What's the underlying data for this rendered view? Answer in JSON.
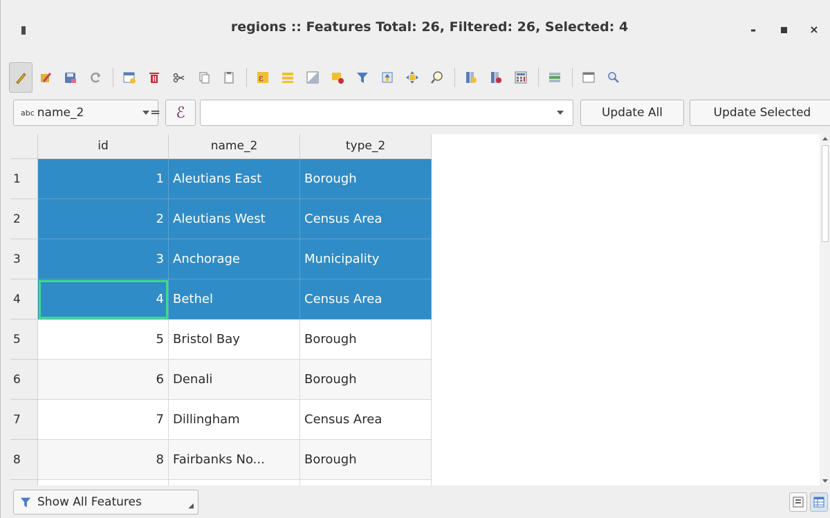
{
  "window": {
    "title": "regions :: Features Total: 26, Filtered: 26, Selected: 4",
    "minimize_glyph": "-",
    "close_glyph": "×"
  },
  "toolbar": {
    "icons": [
      "edit-pencil-icon",
      "multi-edit-icon",
      "save-edits-icon",
      "reload-icon",
      "add-feature-icon",
      "delete-feature-icon",
      "cut-icon",
      "copy-icon",
      "paste-icon",
      "select-by-expression-icon",
      "select-all-icon",
      "invert-selection-icon",
      "deselect-all-icon",
      "filter-select-icon",
      "move-selection-top-icon",
      "pan-to-selection-icon",
      "zoom-to-selection-icon",
      "new-field-icon",
      "delete-field-icon",
      "field-calculator-icon",
      "conditional-formatting-icon",
      "dock-icon",
      "actions-icon"
    ]
  },
  "calc": {
    "field_prefix": "abc",
    "field_name": "name_2",
    "equals": "=",
    "expression_symbol": "ℰ",
    "expression_value": "",
    "update_all": "Update All",
    "update_selected": "Update Selected"
  },
  "table": {
    "columns": [
      "id",
      "name_2",
      "type_2"
    ],
    "rows": [
      {
        "row": "1",
        "id": "1",
        "name_2": "Aleutians East",
        "type_2": "Borough",
        "selected": true
      },
      {
        "row": "2",
        "id": "2",
        "name_2": "Aleutians West",
        "type_2": "Census Area",
        "selected": true
      },
      {
        "row": "3",
        "id": "3",
        "name_2": "Anchorage",
        "type_2": "Municipality",
        "selected": true
      },
      {
        "row": "4",
        "id": "4",
        "name_2": "Bethel",
        "type_2": "Census Area",
        "selected": true
      },
      {
        "row": "5",
        "id": "5",
        "name_2": "Bristol Bay",
        "type_2": "Borough",
        "selected": false
      },
      {
        "row": "6",
        "id": "6",
        "name_2": "Denali",
        "type_2": "Borough",
        "selected": false
      },
      {
        "row": "7",
        "id": "7",
        "name_2": "Dillingham",
        "type_2": "Census Area",
        "selected": false
      },
      {
        "row": "8",
        "id": "8",
        "name_2": "Fairbanks No...",
        "type_2": "Borough",
        "selected": false
      }
    ]
  },
  "footer": {
    "filter_label": "Show All Features"
  },
  "colors": {
    "selection": "#308cc6",
    "focus_outline": "#3ddc84"
  }
}
